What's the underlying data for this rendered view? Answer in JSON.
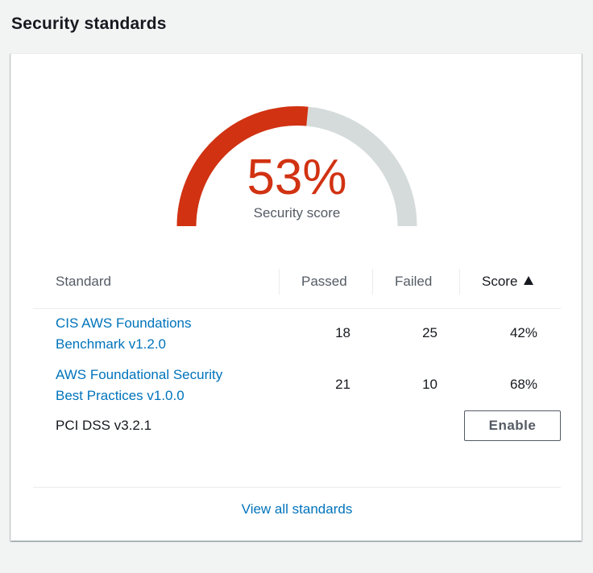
{
  "header": {
    "title": "Security standards"
  },
  "gauge": {
    "value_text": "53%",
    "label": "Security score",
    "score_fraction": 0.53,
    "fill_color": "#d13212",
    "track_color": "#d5dbdb"
  },
  "table": {
    "columns": {
      "standard": "Standard",
      "passed": "Passed",
      "failed": "Failed",
      "score": "Score"
    },
    "sort": {
      "column": "score",
      "direction": "ascending",
      "icon": "caret-up-icon"
    },
    "rows": [
      {
        "name_line1": "CIS AWS Foundations",
        "name_line2": "Benchmark v1.2.0",
        "passed": "18",
        "failed": "25",
        "score": "42%"
      },
      {
        "name_line1": "AWS Foundational Security",
        "name_line2": "Best Practices v1.0.0",
        "passed": "21",
        "failed": "10",
        "score": "68%"
      },
      {
        "name": "PCI DSS v3.2.1",
        "action_label": "Enable"
      }
    ]
  },
  "footer": {
    "link_label": "View all standards"
  },
  "colors": {
    "link": "#0073bb",
    "danger": "#d13212",
    "page_background": "#f2f3f3"
  }
}
